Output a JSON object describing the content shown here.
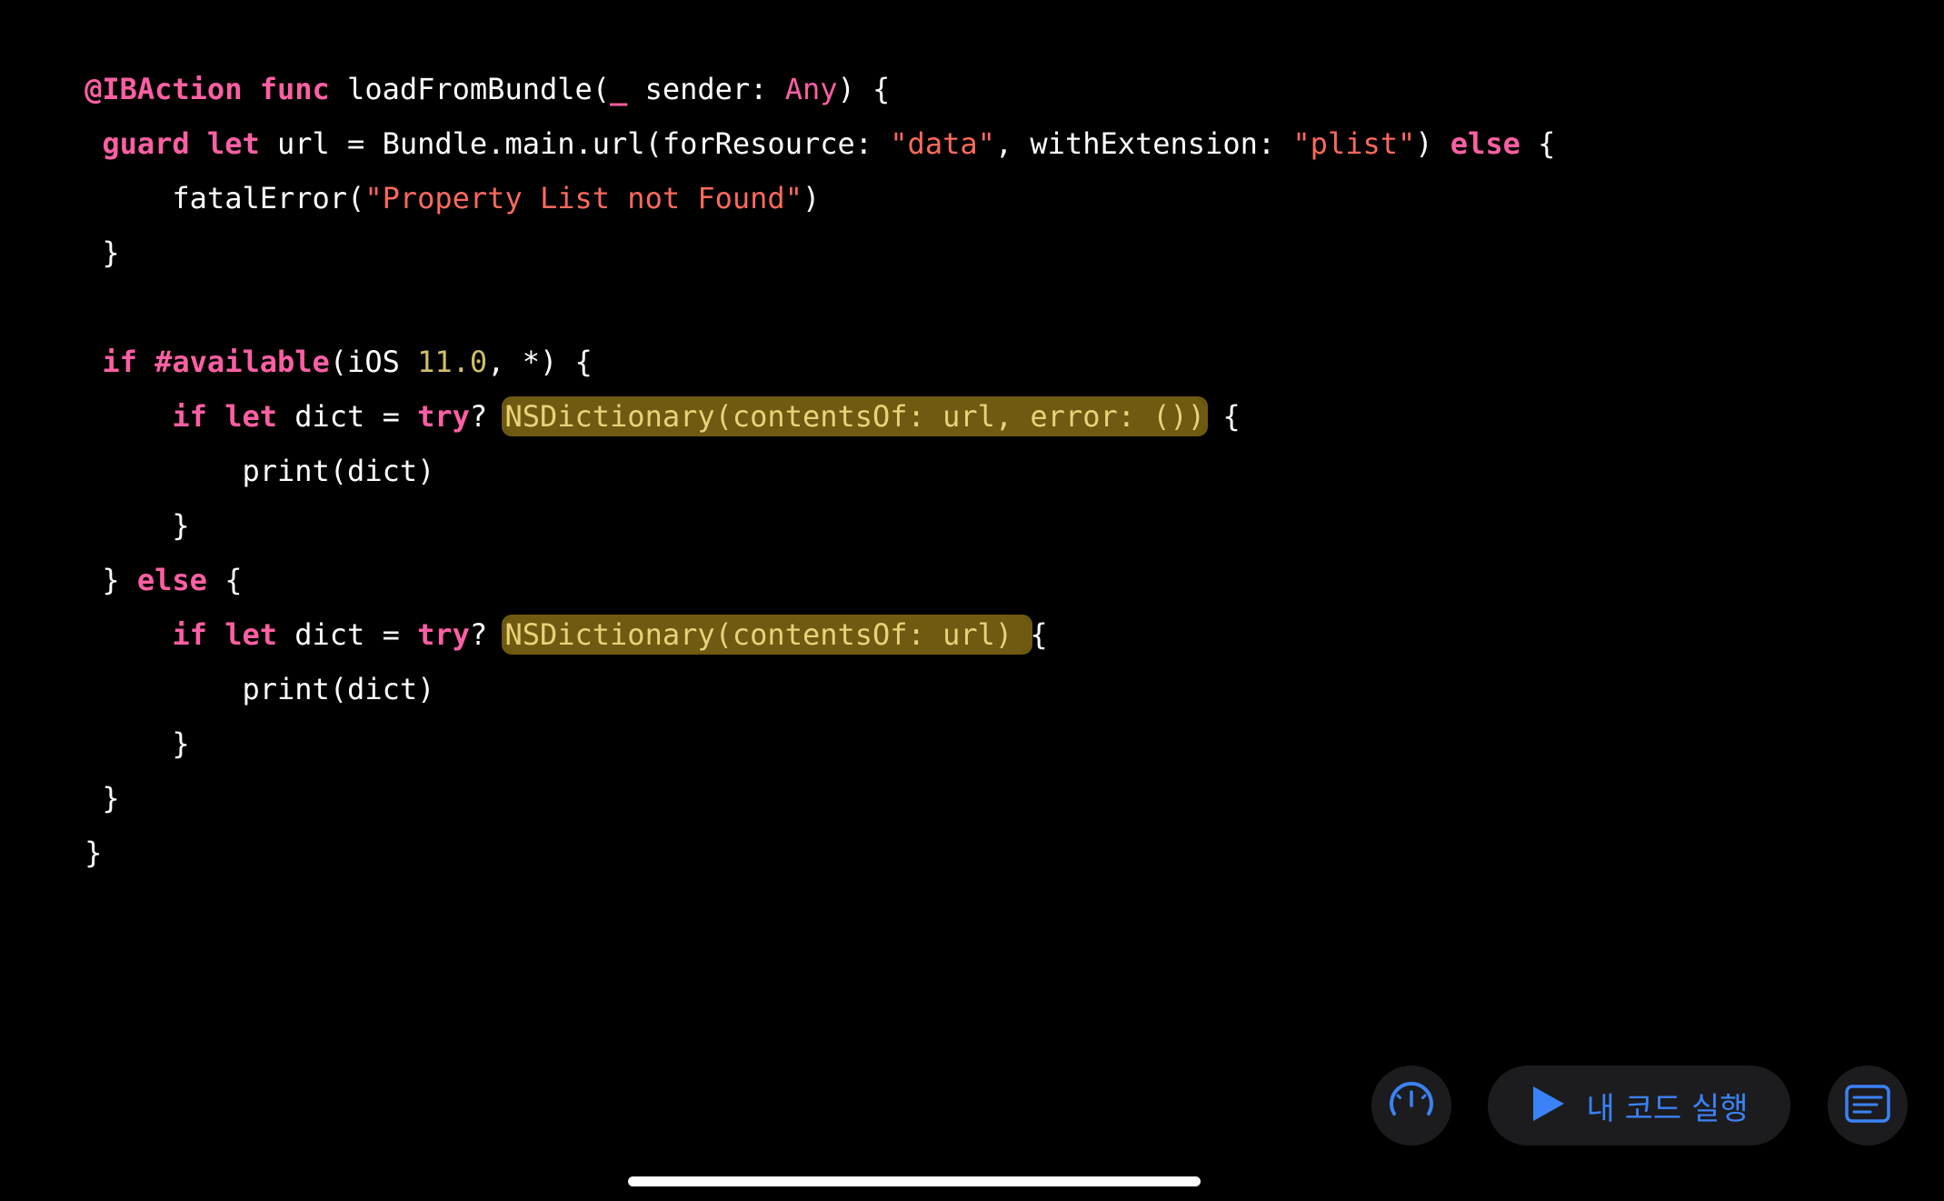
{
  "colors": {
    "background": "#000000",
    "keyword": "#fc5fa3",
    "string": "#fc6a5d",
    "number": "#d0bf69",
    "plain": "#ffffff",
    "highlight_bg": "#6e5a10",
    "highlight_text": "#e8d27a",
    "accent": "#3b82f6",
    "button_bg": "#1c1c1e"
  },
  "code": {
    "line1": [
      "@IBAction",
      " ",
      "func",
      " loadFromBundle(",
      "_",
      " sender: ",
      "Any",
      ") {"
    ],
    "line2": [
      " ",
      "guard",
      " ",
      "let",
      " url = Bundle.main.url(forResource: ",
      "\"data\"",
      ", withExtension: ",
      "\"plist\"",
      ") ",
      "else",
      " {"
    ],
    "line3": [
      "     fatalError(",
      "\"Property List not Found\"",
      ")"
    ],
    "line4": [
      " }"
    ],
    "line6": [
      " ",
      "if",
      " ",
      "#available",
      "(iOS ",
      "11.0",
      ", *) {"
    ],
    "line7": [
      "     ",
      "if",
      " ",
      "let",
      " dict = ",
      "try",
      "? ",
      "NSDictionary(contentsOf: url, error: ())",
      " {"
    ],
    "line8": [
      "         print(dict)"
    ],
    "line9": [
      "     }"
    ],
    "line10": [
      " } ",
      "else",
      " {"
    ],
    "line11": [
      "     ",
      "if",
      " ",
      "let",
      " dict = ",
      "try",
      "? ",
      "NSDictionary(contentsOf: url) ",
      "{"
    ],
    "line12": [
      "         print(dict)"
    ],
    "line13": [
      "     }"
    ],
    "line14": [
      " }"
    ],
    "line15": [
      "}"
    ]
  },
  "toolbar": {
    "speed_icon": "speedometer-icon",
    "run_icon": "play-icon",
    "run_label": "내 코드 실행",
    "notes_icon": "text-lines-icon"
  }
}
